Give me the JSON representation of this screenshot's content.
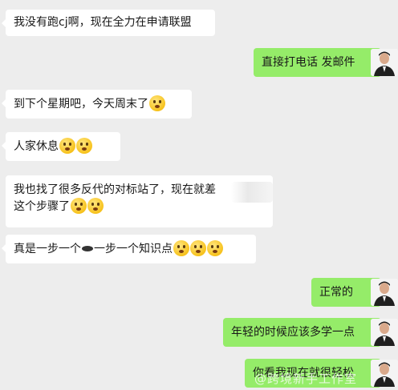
{
  "messages": [
    {
      "side": "in",
      "text": "我没有跑cj啊，现在全力在申请联盟"
    },
    {
      "side": "out",
      "text": "直接打电话 发邮件"
    },
    {
      "side": "in",
      "text": "到下个星期吧，今天周末了",
      "emoji": [
        "grimace-emoji"
      ]
    },
    {
      "side": "in",
      "text": "人家休息",
      "emoji": [
        "crying-emoji",
        "grimace-emoji"
      ]
    },
    {
      "side": "in",
      "line1": "我也找了很多反代的对标站了，现在就差",
      "line2": "这个步骤了",
      "emoji": [
        "crying-emoji",
        "laughing-emoji"
      ]
    },
    {
      "side": "in",
      "part1": "真是一步一个",
      "part2": "一步一个知识点",
      "emoji": [
        "grimace-emoji",
        "grimace-emoji",
        "grimace-emoji"
      ]
    },
    {
      "side": "out",
      "text": "正常的"
    },
    {
      "side": "out",
      "text": "年轻的时候应该多学一点"
    },
    {
      "side": "out",
      "text": "你看我现在就很轻松"
    }
  ],
  "watermark": "@跨境新手工作室"
}
